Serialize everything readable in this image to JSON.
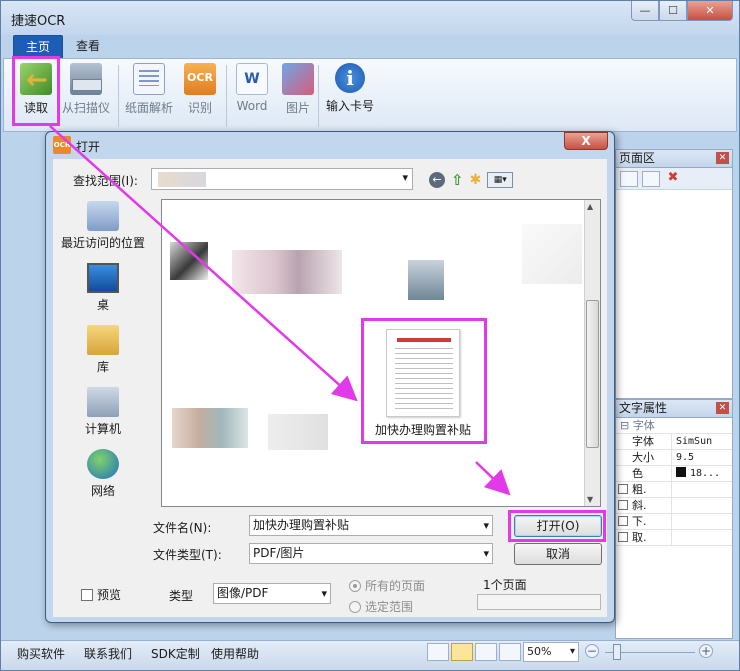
{
  "app": {
    "title": "捷速OCR",
    "window_controls": {
      "minimize": "—",
      "maximize": "☐",
      "close": "✕"
    }
  },
  "ribbon": {
    "tabs": [
      {
        "label": "主页"
      },
      {
        "label": "查看"
      }
    ],
    "buttons": {
      "read": "读取",
      "scan": "从扫描仪",
      "layout": "纸面解析",
      "recognize": "识别",
      "ocr_badge": "OCR",
      "word": "Word",
      "word_badge": "W",
      "picture": "图片",
      "card": "输入卡号",
      "card_badge": "i"
    }
  },
  "pages_panel": {
    "title": "页面区",
    "close": "✕",
    "delete_icon": "✖"
  },
  "text_props_panel": {
    "title": "文字属性",
    "close": "✕",
    "group": "字体",
    "group_toggle": "⊟",
    "rows": [
      {
        "key": "字体",
        "value": "SimSun"
      },
      {
        "key": "大小",
        "value": "9.5"
      },
      {
        "key": "色",
        "value": "18..."
      }
    ],
    "checks": [
      {
        "key": "粗."
      },
      {
        "key": "斜."
      },
      {
        "key": "下."
      },
      {
        "key": "取."
      }
    ]
  },
  "statusbar": {
    "links": [
      "购买软件",
      "联系我们",
      "SDK定制",
      "使用帮助"
    ],
    "zoom": "50%",
    "zoom_out": "−",
    "zoom_in": "+"
  },
  "dialog": {
    "title": "打开",
    "icon": "OCR",
    "close": "X",
    "look_in_label": "查找范围(I):",
    "places": [
      "最近访问的位置",
      "桌",
      "库",
      "计算机",
      "网络"
    ],
    "file": {
      "name": "加快办理购置补贴"
    },
    "file_name_label": "文件名(N):",
    "file_name_value": "加快办理购置补贴",
    "file_type_label": "文件类型(T):",
    "file_type_value": "PDF/图片",
    "open_button": "打开(O)",
    "cancel_button": "取消",
    "preview_label": "预览",
    "type_label": "类型",
    "type_value": "图像/PDF",
    "all_pages": "所有的页面",
    "select_range": "选定范围",
    "page_count": "1个页面"
  },
  "colors": {
    "accent": "#1e5db6",
    "highlight": "#e23ae8"
  }
}
